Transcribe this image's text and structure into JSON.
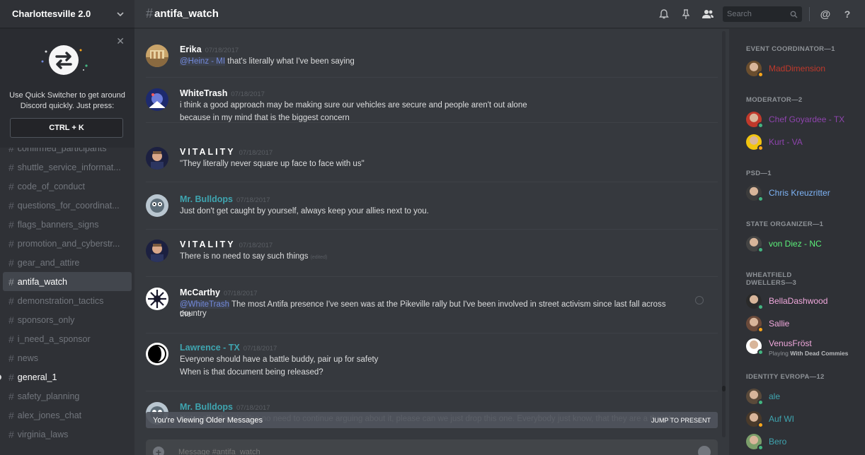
{
  "server": {
    "name": "Charlottesville 2.0"
  },
  "quick_switcher": {
    "text_line1": "Use Quick Switcher to get around",
    "text_line2": "Discord quickly. Just press:",
    "shortcut": "CTRL + K"
  },
  "channels": [
    {
      "name": "confirmed_participants",
      "state": "muted"
    },
    {
      "name": "shuttle_service_informat...",
      "state": "muted"
    },
    {
      "name": "code_of_conduct",
      "state": "muted"
    },
    {
      "name": "questions_for_coordinat...",
      "state": "muted"
    },
    {
      "name": "flags_banners_signs",
      "state": "muted"
    },
    {
      "name": "promotion_and_cyberstr...",
      "state": "muted"
    },
    {
      "name": "gear_and_attire",
      "state": "muted"
    },
    {
      "name": "antifa_watch",
      "state": "active"
    },
    {
      "name": "demonstration_tactics",
      "state": "muted"
    },
    {
      "name": "sponsors_only",
      "state": "muted"
    },
    {
      "name": "i_need_a_sponsor",
      "state": "muted"
    },
    {
      "name": "news",
      "state": "muted"
    },
    {
      "name": "general_1",
      "state": "unread"
    },
    {
      "name": "safety_planning",
      "state": "muted"
    },
    {
      "name": "alex_jones_chat",
      "state": "muted"
    },
    {
      "name": "virginia_laws",
      "state": "muted"
    }
  ],
  "header": {
    "channel": "antifa_watch",
    "search_placeholder": "Search",
    "icons": [
      "bell-icon",
      "pin-icon",
      "members-icon",
      "at-icon",
      "help-icon"
    ]
  },
  "messages": [
    {
      "author": "Erika",
      "author_color": "#ffffff",
      "time": "07/18/2017",
      "lines": [
        {
          "mention": "@Heinz - MI",
          "text": " that's literally what I've been saying"
        }
      ]
    },
    {
      "author": "WhiteTrash",
      "author_color": "#ffffff",
      "time": "07/18/2017",
      "lines": [
        {
          "text": "i think a good approach may be making sure our vehicles are secure and people aren't out alone"
        },
        {
          "text": "because in my mind that is the biggest concern"
        }
      ]
    },
    {
      "author": "VITALITY",
      "author_color": "#ffffff",
      "time": "07/18/2017",
      "lines": [
        {
          "text": "\"They literally never square up face to face with us\""
        }
      ]
    },
    {
      "author": "Mr. Bulldops",
      "author_color": "#3fa5b0",
      "time": "07/18/2017",
      "lines": [
        {
          "text": "Just don't get caught by yourself, always keep your allies next to you."
        }
      ]
    },
    {
      "author": "VITALITY",
      "author_color": "#ffffff",
      "time": "07/18/2017",
      "lines": [
        {
          "text": "There is no need to say such things",
          "edited": "(edited)"
        }
      ]
    },
    {
      "author": "McCarthy",
      "author_color": "#ffffff",
      "time": "07/18/2017",
      "lines": [
        {
          "mention": "@WhiteTrash",
          "text": " The most Antifa presence I've seen was at the Pikeville rally but I've been involved in street activism since last fall across the"
        },
        {
          "text": "country"
        }
      ]
    },
    {
      "author": "Lawrence - TX",
      "author_color": "#3fa5b0",
      "time": "07/18/2017",
      "lines": [
        {
          "text": "Everyone should have a battle buddy, pair up for safety"
        },
        {
          "text": "When is that document being released?"
        }
      ]
    },
    {
      "author": "Mr. Bulldops",
      "author_color": "#3fa5b0",
      "time": "07/18/2017",
      "lines": [
        {
          "text": "Not really, there's also no need to continue arguing about it, please can we just drop this one. Everybody just know, that they are a threat."
        }
      ]
    }
  ],
  "older_messages_bar": {
    "label": "You're Viewing Older Messages",
    "jump": "JUMP TO PRESENT"
  },
  "composer": {
    "placeholder": "Message #antifa_watch"
  },
  "member_groups": [
    {
      "role": "EVENT COORDINATOR—1",
      "members": [
        {
          "name": "MadDimension",
          "color": "#c0392b",
          "status": "idle"
        }
      ]
    },
    {
      "role": "MODERATOR—2",
      "members": [
        {
          "name": "Chef Goyardee - TX",
          "color": "#8e44ad",
          "status": "online"
        },
        {
          "name": "Kurt - VA",
          "color": "#8e44ad",
          "status": "idle"
        }
      ]
    },
    {
      "role": "PSD—1",
      "members": [
        {
          "name": "Chris Kreuzritter",
          "color": "#7eb4f7",
          "status": "online"
        }
      ]
    },
    {
      "role": "STATE ORGANIZER—1",
      "members": [
        {
          "name": "von Diez - NC",
          "color": "#5cf07a",
          "status": "online"
        }
      ]
    },
    {
      "role": "WHEATFIELD DWELLERS—3",
      "members": [
        {
          "name": "BellaDashwood",
          "color": "#f0a8dc",
          "status": "online"
        },
        {
          "name": "Sallie",
          "color": "#f0a8dc",
          "status": "idle"
        },
        {
          "name": "VenusFröst",
          "color": "#f0a8dc",
          "status": "online",
          "activity_prefix": "Playing ",
          "activity": "With Dead Commies"
        }
      ]
    },
    {
      "role": "IDENTITY EVROPA—12",
      "members": [
        {
          "name": "ale",
          "color": "#3fa5b0",
          "status": "online"
        },
        {
          "name": "Auf WI",
          "color": "#3fa5b0",
          "status": "idle"
        },
        {
          "name": "Bero",
          "color": "#3fa5b0",
          "status": "online"
        }
      ]
    }
  ],
  "colors": {
    "online": "#43b581",
    "idle": "#faa61a",
    "mention": "#7289da",
    "active_channel_bg": "#42464d"
  }
}
